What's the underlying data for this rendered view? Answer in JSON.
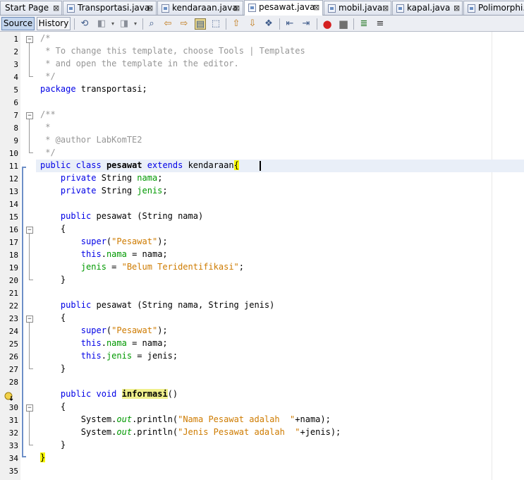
{
  "tabs": [
    {
      "label": "Start Page",
      "close": "⊠",
      "active": false,
      "icon": false
    },
    {
      "label": "Transportasi.java",
      "close": "⊠",
      "active": false,
      "icon": true
    },
    {
      "label": "kendaraan.java",
      "close": "⊠",
      "active": false,
      "icon": true
    },
    {
      "label": "pesawat.java",
      "close": "⊠",
      "active": true,
      "icon": true
    },
    {
      "label": "mobil.java",
      "close": "⊠",
      "active": false,
      "icon": true
    },
    {
      "label": "kapal.java",
      "close": "⊠",
      "active": false,
      "icon": true
    },
    {
      "label": "Polimorphi...",
      "close": "",
      "active": false,
      "icon": true
    }
  ],
  "toolbar": {
    "source_label": "Source",
    "history_label": "History",
    "icons": [
      "last-edit-icon",
      "back-icon",
      "forward-icon",
      "find-icon",
      "find-previous-icon",
      "find-next-icon",
      "toggle-highlight-icon",
      "find-selection-icon",
      "previous-bookmark-icon",
      "next-bookmark-icon",
      "toggle-bookmark-icon",
      "shift-left-icon",
      "shift-right-icon",
      "start-macro-icon",
      "stop-macro-icon",
      "comment-icon",
      "uncomment-icon"
    ]
  },
  "editor": {
    "current_line": 11,
    "lines": [
      {
        "n": "1",
        "t": "/*"
      },
      {
        "n": "2",
        "t": " * To change this template, choose Tools | Templates"
      },
      {
        "n": "3",
        "t": " * and open the template in the editor."
      },
      {
        "n": "4",
        "t": " */"
      },
      {
        "n": "5",
        "t": "package transportasi;"
      },
      {
        "n": "6",
        "t": ""
      },
      {
        "n": "7",
        "t": "/**"
      },
      {
        "n": "8",
        "t": " *"
      },
      {
        "n": "9",
        "t": " * @author LabKomTE2"
      },
      {
        "n": "10",
        "t": " */"
      },
      {
        "n": "11",
        "t": "public class pesawat extends kendaraan{"
      },
      {
        "n": "12",
        "t": "    private String nama;"
      },
      {
        "n": "13",
        "t": "    private String jenis;"
      },
      {
        "n": "14",
        "t": ""
      },
      {
        "n": "15",
        "t": "    public pesawat (String nama)"
      },
      {
        "n": "16",
        "t": "    {"
      },
      {
        "n": "17",
        "t": "        super(\"Pesawat\");"
      },
      {
        "n": "18",
        "t": "        this.nama = nama;"
      },
      {
        "n": "19",
        "t": "        jenis = \"Belum Teridentifikasi\";"
      },
      {
        "n": "20",
        "t": "    }"
      },
      {
        "n": "21",
        "t": ""
      },
      {
        "n": "22",
        "t": "    public pesawat (String nama, String jenis)"
      },
      {
        "n": "23",
        "t": "    {"
      },
      {
        "n": "24",
        "t": "        super(\"Pesawat\");"
      },
      {
        "n": "25",
        "t": "        this.nama = nama;"
      },
      {
        "n": "26",
        "t": "        this.jenis = jenis;"
      },
      {
        "n": "27",
        "t": "    }"
      },
      {
        "n": "28",
        "t": ""
      },
      {
        "n": "29",
        "t": "    public void informasi()"
      },
      {
        "n": "30",
        "t": "    {"
      },
      {
        "n": "31",
        "t": "        System.out.println(\"Nama Pesawat adalah  \"+nama);"
      },
      {
        "n": "32",
        "t": "        System.out.println(\"Jenis Pesawat adalah  \"+jenis);"
      },
      {
        "n": "33",
        "t": "    }"
      },
      {
        "n": "34",
        "t": "}"
      },
      {
        "n": "35",
        "t": ""
      }
    ]
  },
  "colors": {
    "keyword": "#0000e6",
    "comment": "#969696",
    "field": "#009900",
    "string": "#ce7b00",
    "current_line": "#e9eff8"
  }
}
